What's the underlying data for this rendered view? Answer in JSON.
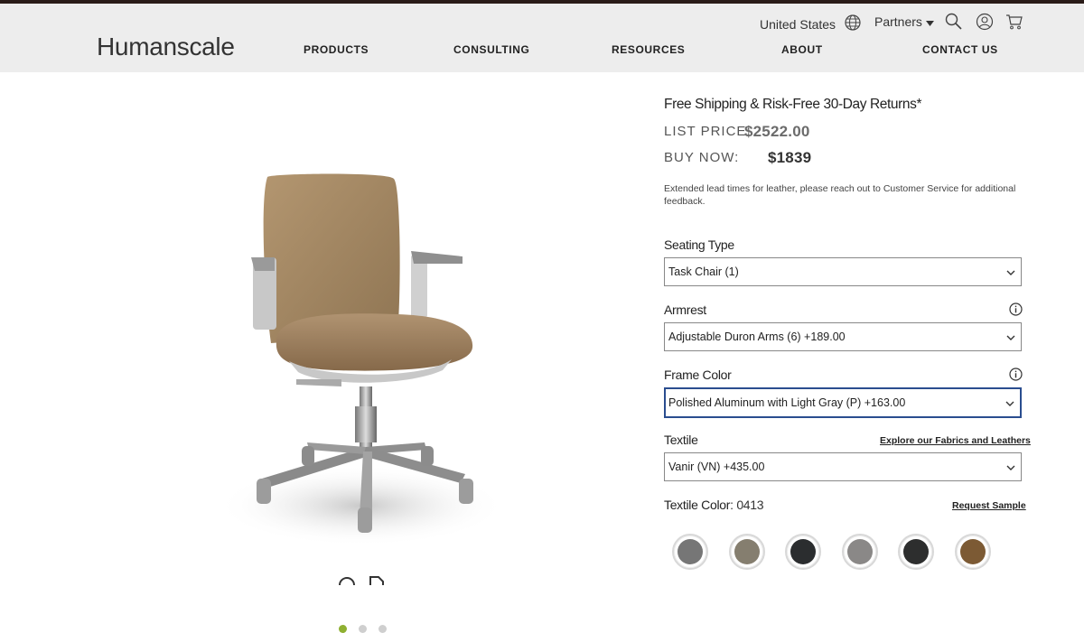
{
  "header": {
    "logo": "Humanscale",
    "region": "United States",
    "partners": "Partners",
    "nav": [
      "PRODUCTS",
      "CONSULTING",
      "RESOURCES",
      "ABOUT",
      "CONTACT US"
    ]
  },
  "product": {
    "shipping": "Free Shipping & Risk-Free 30-Day Returns*",
    "list_price_label": "LIST PRICE:",
    "list_price": "$2522.00",
    "buy_now_label": "BUY NOW:",
    "buy_now_price": "$1839",
    "note": "Extended lead times for leather, please reach out to Customer Service for additional feedback."
  },
  "options": {
    "seating_type": {
      "label": "Seating Type",
      "value": "Task Chair (1)"
    },
    "armrest": {
      "label": "Armrest",
      "value": "Adjustable Duron Arms (6) +189.00"
    },
    "frame_color": {
      "label": "Frame Color",
      "value": "Polished Aluminum with Light Gray (P) +163.00"
    },
    "textile": {
      "label": "Textile",
      "link": "Explore our Fabrics and Leathers",
      "value": "Vanir (VN) +435.00"
    },
    "textile_color": {
      "label": "Textile Color",
      "value": ": 0413",
      "link": "Request Sample"
    }
  },
  "swatches": [
    "#767676",
    "#857e6f",
    "#2b2d2f",
    "#8a8887",
    "#2d2e2e",
    "#7c5a34"
  ],
  "gallery": {
    "active_index": 0,
    "count": 3
  },
  "colors": {
    "accent_green": "#8fb031",
    "focus_blue": "#2a4d8f",
    "header_bg": "#ededed"
  }
}
